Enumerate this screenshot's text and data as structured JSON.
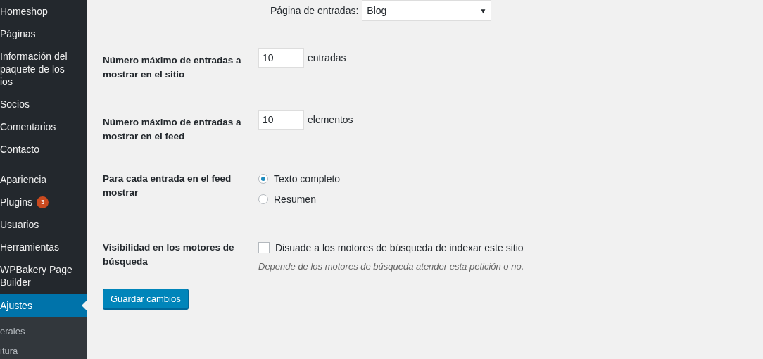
{
  "sidebar": {
    "items": [
      {
        "label": "Homeshop",
        "selected": false
      },
      {
        "label": "Páginas",
        "selected": false
      },
      {
        "label": "Información del paquete de los ios",
        "selected": false
      },
      {
        "label": "Socios",
        "selected": false
      },
      {
        "label": "Comentarios",
        "selected": false
      },
      {
        "label": "Contacto",
        "selected": false
      },
      {
        "label": "Apariencia",
        "selected": false
      },
      {
        "label": "Plugins",
        "selected": false,
        "badge": "3"
      },
      {
        "label": "Usuarios",
        "selected": false
      },
      {
        "label": "Herramientas",
        "selected": false
      },
      {
        "label": "WPBakery Page Builder",
        "selected": false
      },
      {
        "label": "Ajustes",
        "selected": true
      }
    ],
    "submenu": [
      {
        "label": "erales"
      },
      {
        "label": "itura"
      }
    ]
  },
  "posts_page": {
    "label": "Página de entradas:",
    "value": "Blog",
    "arrow": "▼"
  },
  "settings": [
    {
      "kind": "number",
      "label": "Número máximo de entradas a mostrar en el sitio",
      "value": "10",
      "unit": "entradas"
    },
    {
      "kind": "number",
      "label": "Número máximo de entradas a mostrar en el feed",
      "value": "10",
      "unit": "elementos"
    },
    {
      "kind": "radio",
      "label": "Para cada entrada en el feed mostrar",
      "options": [
        {
          "label": "Texto completo",
          "selected": true
        },
        {
          "label": "Resumen",
          "selected": false
        }
      ]
    },
    {
      "kind": "checkbox",
      "label": "Visibilidad en los motores de búsqueda",
      "option": "Disuade a los motores de búsqueda de indexar este sitio",
      "checked": false,
      "description": "Depende de los motores de búsqueda atender esta petición o no."
    }
  ],
  "save_button": "Guardar cambios"
}
